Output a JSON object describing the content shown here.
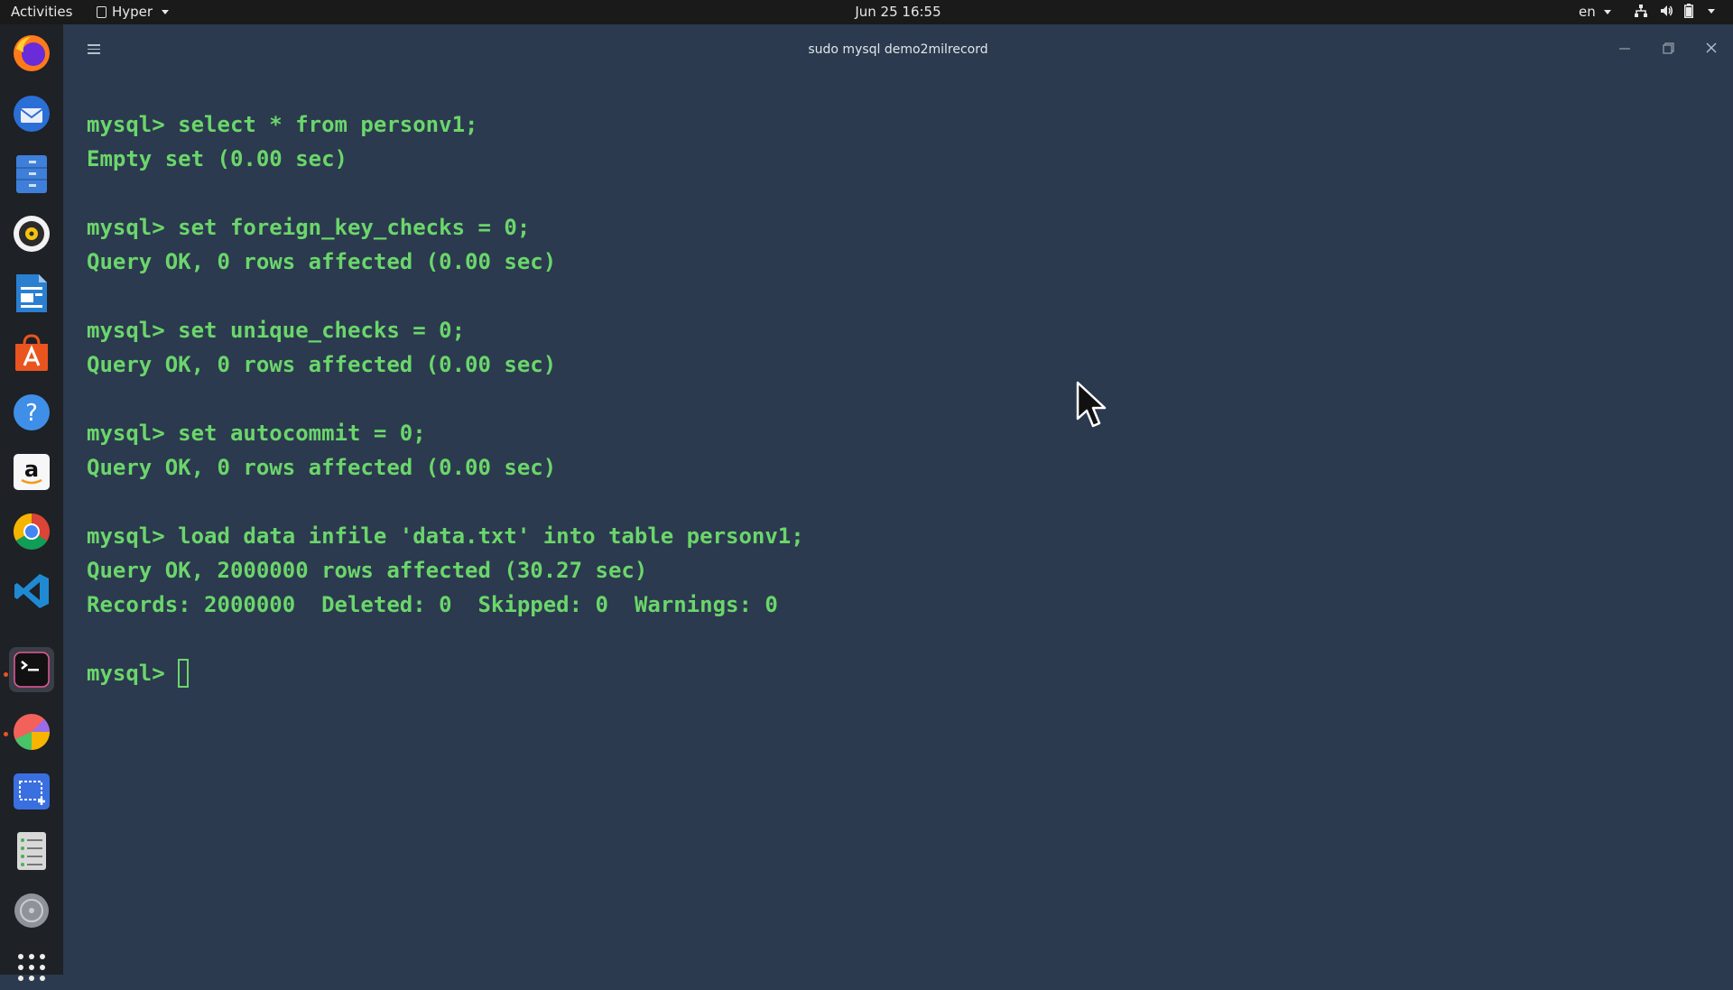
{
  "topbar": {
    "activities": "Activities",
    "app_name": "Hyper",
    "clock": "Jun 25  16:55",
    "language": "en"
  },
  "dock": {
    "apps": [
      {
        "name": "firefox-icon"
      },
      {
        "name": "thunderbird-icon"
      },
      {
        "name": "files-icon"
      },
      {
        "name": "rhythmbox-icon"
      },
      {
        "name": "writer-icon"
      },
      {
        "name": "software-center-icon"
      },
      {
        "name": "help-icon"
      },
      {
        "name": "amazon-icon"
      },
      {
        "name": "chrome-icon"
      },
      {
        "name": "vscode-icon"
      },
      {
        "name": "terminal-icon",
        "active": true
      },
      {
        "name": "color-picker-icon"
      },
      {
        "name": "screenshot-icon"
      },
      {
        "name": "notes-icon"
      },
      {
        "name": "disk-icon"
      },
      {
        "name": "show-apps-icon"
      }
    ]
  },
  "window": {
    "title": "sudo mysql demo2milrecord"
  },
  "terminal": {
    "lines": [
      "mysql> select * from personv1;",
      "Empty set (0.00 sec)",
      "",
      "mysql> set foreign_key_checks = 0;",
      "Query OK, 0 rows affected (0.00 sec)",
      "",
      "mysql> set unique_checks = 0;",
      "Query OK, 0 rows affected (0.00 sec)",
      "",
      "mysql> set autocommit = 0;",
      "Query OK, 0 rows affected (0.00 sec)",
      "",
      "mysql> load data infile 'data.txt' into table personv1;",
      "Query OK, 2000000 rows affected (30.27 sec)",
      "Records: 2000000  Deleted: 0  Skipped: 0  Warnings: 0",
      ""
    ],
    "prompt": "mysql>",
    "text_color": "#6bd66b",
    "background": "#2b3a4e"
  }
}
